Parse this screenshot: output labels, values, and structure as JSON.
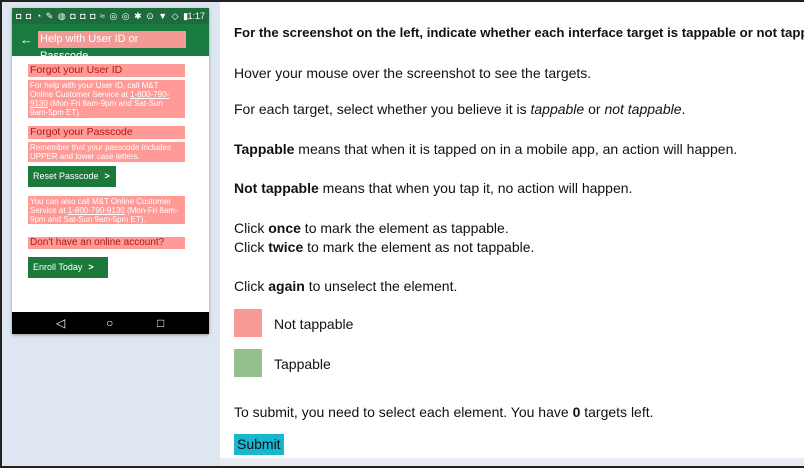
{
  "phone": {
    "status_time": "1:17",
    "status_icons": "◘ ◘ ◔ ✎ ◍ ◘ ◘ ◘ ≈ ◎ ◎ ✱ ⊙ ▼ ◇ ▮",
    "back_glyph": "←",
    "title": "Help with User ID or Passcode",
    "sections": {
      "forgot_user_id": "Forgot your User ID",
      "user_id_body_1": "For help with your User ID, call M&T Online Customer Service at ",
      "user_id_phone": "1-800-790-9130",
      "user_id_body_2": " (Mon-Fri 8am-9pm and Sat-Sun 9am-5pm ET).",
      "forgot_passcode": "Forgot your Passcode",
      "passcode_body": "Remember that your passcode includes UPPER and lower case letters.",
      "reset_button": "Reset Passcode",
      "call_body_1": "You can also call M&T Online Customer Service at ",
      "call_phone": "1-800-790-9130",
      "call_body_2": " (Mon-Fri 8am-9pm and Sat-Sun 9am-5pm ET).",
      "no_account": "Don't have an online account?",
      "enroll_button": "Enroll Today",
      "chevron": ">"
    },
    "nav": {
      "back": "◁",
      "home": "○",
      "recents": "□"
    }
  },
  "instructions": {
    "heading": "For the screenshot on the left, indicate whether each interface target is tappable or not tappable.",
    "hover": "Hover your mouse over the screenshot to see the targets.",
    "select_pre": "For each target, select whether you believe it is ",
    "select_tappable": "tappable",
    "select_or": " or ",
    "select_not": "not tappable",
    "select_end": ".",
    "tappable_term": "Tappable",
    "tappable_def": " means that when it is tapped on in a mobile app, an action will happen.",
    "not_tappable_term": "Not tappable",
    "not_tappable_def": " means that when you tap it, no action will happen.",
    "click_pre": "Click ",
    "once": "once",
    "once_post": " to mark the element as tappable.",
    "twice": "twice",
    "twice_post": " to mark the element as not tappable.",
    "again": "again",
    "again_post": " to unselect the element."
  },
  "legend": {
    "not_tappable_label": "Not tappable",
    "not_tappable_color": "#f99a96",
    "tappable_label": "Tappable",
    "tappable_color": "#93c08d"
  },
  "submit": {
    "text_pre": "To submit, you need to select each element. You have ",
    "count": "0",
    "text_post": " targets left.",
    "button_label": "Submit"
  }
}
